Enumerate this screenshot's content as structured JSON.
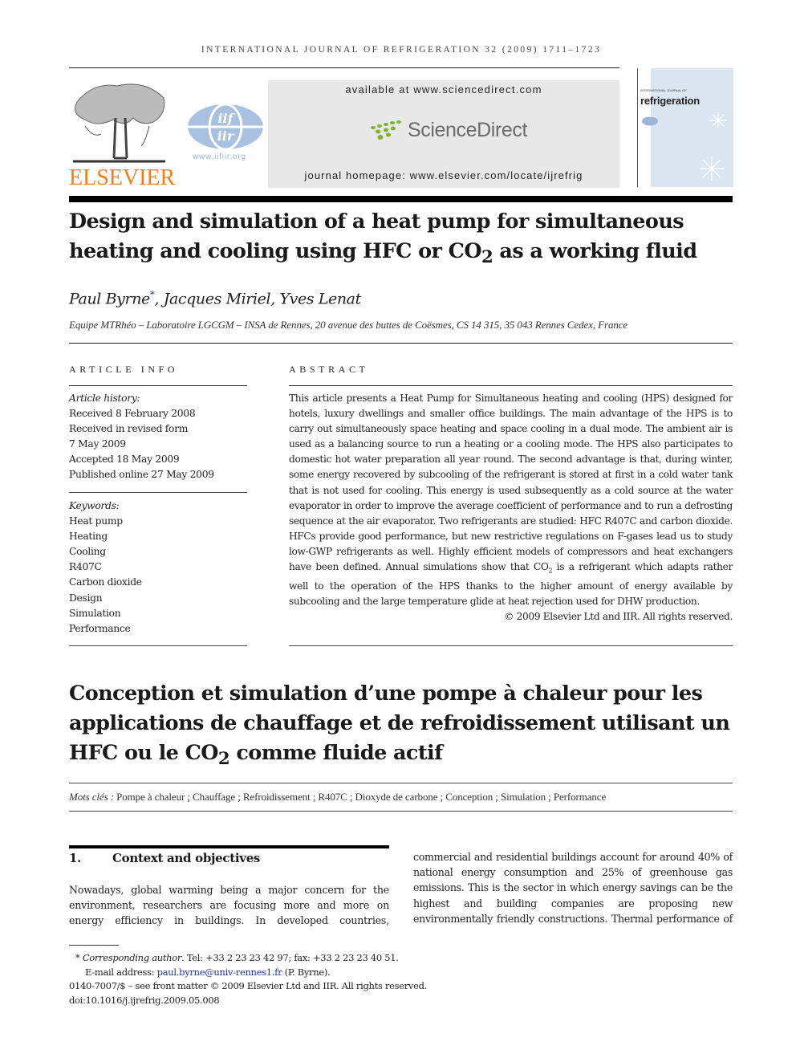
{
  "header": {
    "running_head": "International Journal of Refrigeration 32 (2009) 1711–1723",
    "elsevier_logo_text": "ELSEVIER",
    "iif_logo_text_top": "iif",
    "iif_logo_text_bottom": "iir",
    "iif_url": "www.iifiir.org",
    "sd_available": "available at www.sciencedirect.com",
    "sd_logo_text": "ScienceDirect",
    "sd_homepage": "journal homepage: www.elsevier.com/locate/ijrefrig",
    "cover_small": "INTERNATIONAL JOURNAL OF",
    "cover_title": "refrigeration",
    "colors": {
      "elsevier_orange": "#f07f1a",
      "sd_green": "#7bb32e",
      "iif_blue": "#a9c1e0",
      "link_blue": "#1f3a8a"
    }
  },
  "article": {
    "title_pre": "Design and simulation of a heat pump for simultaneous heating and cooling using HFC or CO",
    "title_sub": "2",
    "title_post": " as a working fluid",
    "authors": "Paul Byrne",
    "author_marker": "*",
    "authors_rest": ", Jacques Miriel, Yves Lenat",
    "affiliation": "Equipe MTRhéo – Laboratoire LGCGM – INSA de Rennes, 20 avenue des buttes de Coësmes, CS 14 315, 35 043 Rennes Cedex, France"
  },
  "article_info": {
    "label": "ARTICLE INFO",
    "history_label": "Article history:",
    "history": [
      "Received 8 February 2008",
      "Received in revised form",
      "7 May 2009",
      "Accepted 18 May 2009",
      "Published online 27 May 2009"
    ],
    "keywords_label": "Keywords:",
    "keywords": [
      "Heat pump",
      "Heating",
      "Cooling",
      "R407C",
      "Carbon dioxide",
      "Design",
      "Simulation",
      "Performance"
    ]
  },
  "abstract": {
    "label": "ABSTRACT",
    "text_pre": "This article presents a Heat Pump for Simultaneous heating and cooling (HPS) designed for hotels, luxury dwellings and smaller office buildings. The main advantage of the HPS is to carry out simultaneously space heating and space cooling in a dual mode. The ambient air is used as a balancing source to run a heating or a cooling mode. The HPS also participates to domestic hot water preparation all year round. The second advantage is that, during winter, some energy recovered by subcooling of the refrigerant is stored at first in a cold water tank that is not used for cooling. This energy is used subsequently as a cold source at the water evaporator in order to improve the average coefficient of performance and to run a defrosting sequence at the air evaporator. Two refrigerants are studied: HFC R407C and carbon dioxide. HFCs provide good performance, but new restrictive regulations on F-gases lead us to study low-GWP refrigerants as well. Highly efficient models of compressors and heat exchangers have been defined. Annual simulations show that CO",
    "text_sub": "2",
    "text_post": " is a refrigerant which adapts rather well to the operation of the HPS thanks to the higher amount of energy available by subcooling and the large temperature glide at heat rejection used for DHW production.",
    "copyright": "© 2009 Elsevier Ltd and IIR. All rights reserved."
  },
  "french": {
    "title_pre": "Conception et simulation d’une pompe à chaleur pour les applications de chauffage et de refroidissement utilisant un HFC ou le CO",
    "title_sub": "2",
    "title_post": " comme fluide actif",
    "mots_label": "Mots clés :",
    "mots": " Pompe à chaleur ; Chauffage ; Refroidissement ; R407C ; Dioxyde de carbone ; Conception ; Simulation ; Performance"
  },
  "section1": {
    "number": "1.",
    "heading": "Context and objectives",
    "col1": "Nowadays, global warming being a major concern for the environment, researchers are focusing more and more on energy efficiency in buildings. In developed countries,",
    "col2": "commercial and residential buildings account for around 40% of national energy consumption and 25% of greenhouse gas emissions. This is the sector in which energy savings can be the highest and building companies are proposing new environmentally friendly constructions. Thermal performance of"
  },
  "footnotes": {
    "marker": "*",
    "corr_label": "Corresponding author",
    "corr_text": ". Tel: +33 2 23 23 42 97; fax: +33 2 23 23 40 51.",
    "email_label": "E-mail address: ",
    "email": "paul.byrne@univ-rennes1.fr",
    "email_after": " (P. Byrne).",
    "front_matter": "0140-7007/$ – see front matter © 2009 Elsevier Ltd and IIR. All rights reserved.",
    "doi": "doi:10.1016/j.ijrefrig.2009.05.008"
  }
}
